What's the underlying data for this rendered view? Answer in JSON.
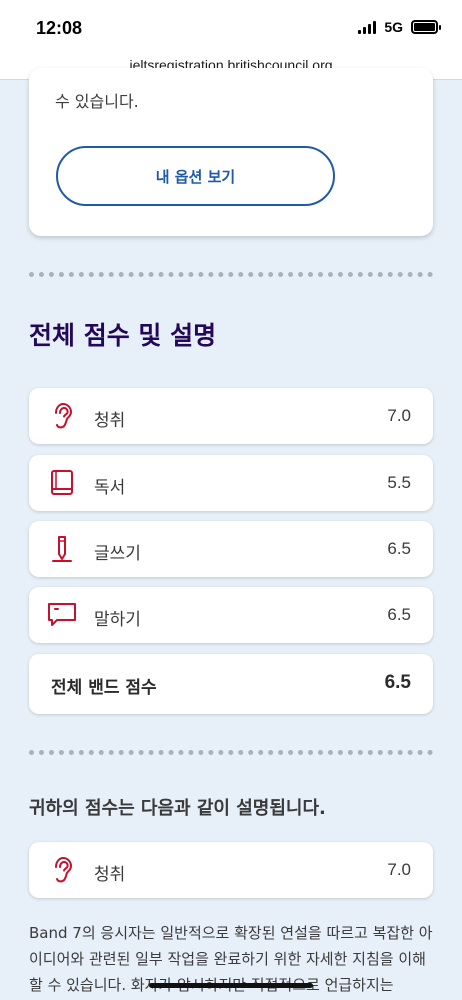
{
  "status": {
    "time": "12:08",
    "network": "5G"
  },
  "browser": {
    "url": "ieltsregistration.britishcouncil.org"
  },
  "options_card": {
    "text": "수 있습니다.",
    "button_label": "내 옵션 보기"
  },
  "overall": {
    "title": "전체 점수 및 설명",
    "rows": [
      {
        "label": "청취",
        "score": "7.0",
        "icon": "ear-icon"
      },
      {
        "label": "독서",
        "score": "5.5",
        "icon": "book-icon"
      },
      {
        "label": "글쓰기",
        "score": "6.5",
        "icon": "pencil-icon"
      },
      {
        "label": "말하기",
        "score": "6.5",
        "icon": "speech-bubble-icon"
      }
    ],
    "total_label": "전체 밴드 점수",
    "total_score": "6.5"
  },
  "explanation": {
    "title": "귀하의 점수는 다음과 같이 설명됩니다.",
    "row": {
      "label": "청취",
      "score": "7.0",
      "icon": "ear-icon"
    },
    "body": "Band 7의 응시자는 일반적으로 확장된 연설을 따르고 복잡한 아이디어와 관련된 일부 작업을 완료하기 위한 자세한 지침을 이해할 수 있습니다. 화자가 암시하지만 직접적으로 언급하지는"
  },
  "colors": {
    "accent": "#1f5ba4",
    "heading": "#23085a",
    "icon": "#c8102e",
    "background": "#e7eff8"
  }
}
